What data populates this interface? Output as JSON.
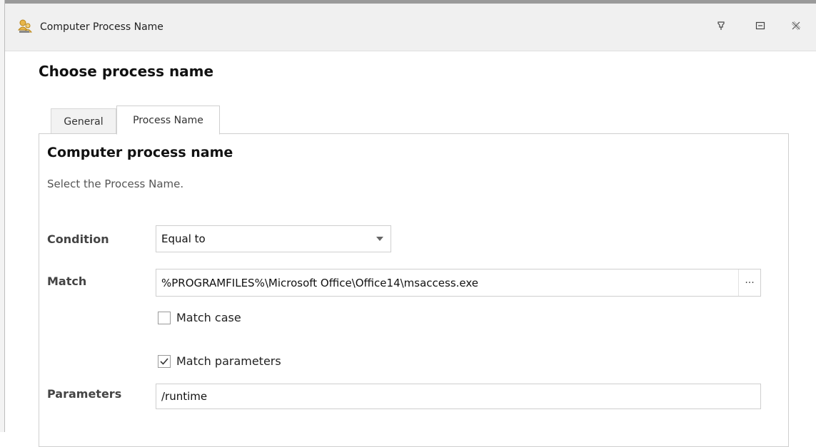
{
  "window": {
    "title": "Computer Process Name",
    "icon": "users-process-icon",
    "controls": [
      "pin-icon",
      "maximize-icon",
      "close-icon"
    ]
  },
  "page": {
    "title": "Choose process name"
  },
  "tabs": [
    {
      "label": "General",
      "active": false
    },
    {
      "label": "Process Name",
      "active": true
    }
  ],
  "section": {
    "title": "Computer process name",
    "description": "Select the Process Name."
  },
  "form": {
    "condition": {
      "label": "Condition",
      "value": "Equal to"
    },
    "match": {
      "label": "Match",
      "value": "%PROGRAMFILES%\\Microsoft Office\\Office14\\msaccess.exe",
      "browse_label": "···"
    },
    "match_case": {
      "label": "Match case",
      "checked": false
    },
    "match_parameters": {
      "label": "Match parameters",
      "checked": true
    },
    "parameters": {
      "label": "Parameters",
      "value": "/runtime"
    }
  }
}
